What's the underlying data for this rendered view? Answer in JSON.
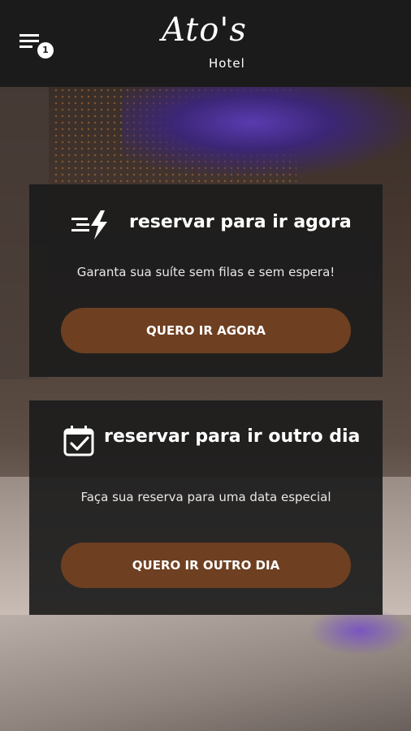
{
  "header": {
    "menu_badge": "1",
    "logo_main": "Ato's",
    "logo_sub": "Hotel"
  },
  "cards": [
    {
      "icon": "fast-lightning-icon",
      "title": "reservar para ir agora",
      "description": "Garanta sua suíte sem filas e sem espera!",
      "button_label": "QUERO IR AGORA"
    },
    {
      "icon": "calendar-check-icon",
      "title": "reservar para ir outro dia",
      "description": "Faça sua reserva para uma data especial",
      "button_label": "QUERO IR OUTRO DIA"
    }
  ],
  "colors": {
    "header_bg": "#1b1b1b",
    "card_bg": "#1c1c1c",
    "button_bg": "#6e3f21",
    "text": "#ffffff"
  }
}
